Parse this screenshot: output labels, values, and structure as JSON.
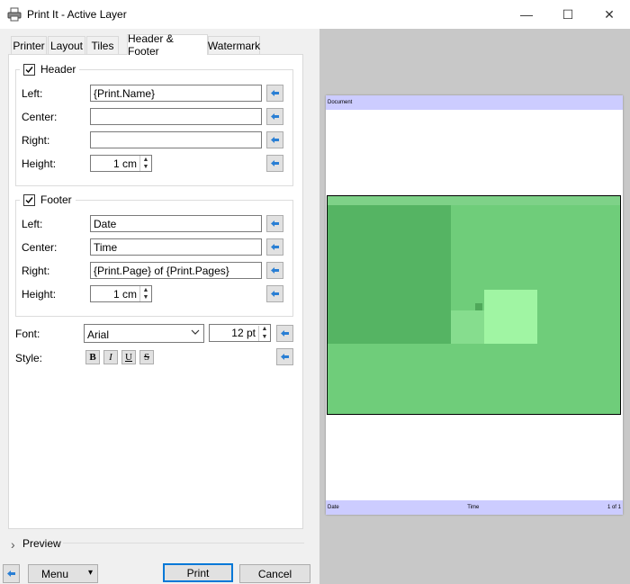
{
  "window": {
    "title": "Print It - Active Layer",
    "minimize": "—",
    "maximize": "☐",
    "close": "✕"
  },
  "tabs": [
    "Printer",
    "Layout",
    "Tiles",
    "Header & Footer",
    "Watermark"
  ],
  "active_tab": "Header & Footer",
  "header": {
    "legend": "Header",
    "checked": true,
    "left_label": "Left:",
    "left_value": "{Print.Name}",
    "center_label": "Center:",
    "center_value": "",
    "right_label": "Right:",
    "right_value": "",
    "height_label": "Height:",
    "height_value": "1 cm"
  },
  "footer": {
    "legend": "Footer",
    "checked": true,
    "left_label": "Left:",
    "left_value": "Date",
    "center_label": "Center:",
    "center_value": "Time",
    "right_label": "Right:",
    "right_value": "{Print.Page} of {Print.Pages}",
    "height_label": "Height:",
    "height_value": "1 cm"
  },
  "font": {
    "label": "Font:",
    "family": "Arial",
    "size": "12 pt",
    "style_label": "Style:",
    "bold": "B",
    "italic": "I",
    "underline": "U",
    "strike": "S"
  },
  "preview_toggle": {
    "label": "Preview",
    "chevron": "›"
  },
  "buttons": {
    "menu": "Menu",
    "menu_arrow": "▾",
    "print": "Print",
    "cancel": "Cancel"
  },
  "page_preview": {
    "header_text": "Document",
    "footer_left": "Date",
    "footer_center": "Time",
    "footer_right": "1 of 1"
  },
  "colors": {
    "accent": "#0078d7",
    "band": "#ccccff",
    "image_light": "#6fcd7a",
    "image_dark": "#55b463"
  }
}
